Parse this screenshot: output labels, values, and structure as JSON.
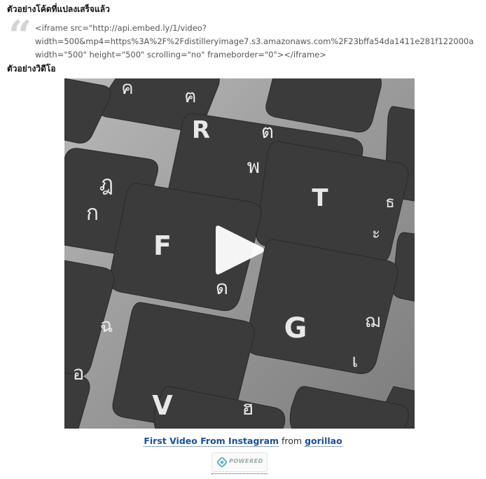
{
  "headings": {
    "converted_code": "ตัวอย่างโค้ดที่แปลงเสร็จแล้ว",
    "video_example": "ตัวอย่างวิดีโอ"
  },
  "code": {
    "line1": "<iframe src=\"http://api.embed.ly/1/video?",
    "line2": "width=500&mp4=https%3A%2F%2Fdistilleryimage7.s3.amazonaws.com%2F23bffa54da1411e281f122000a",
    "line3": "width=\"500\" height=\"500\" scrolling=\"no\" frameborder=\"0\"></iframe>"
  },
  "video": {
    "keys": {
      "k1": "ค",
      "k2": "ฅ",
      "k3": "R",
      "k4": "ต",
      "k5": "พ",
      "k6": "ฎ",
      "k7": "ก",
      "k8": "F",
      "k9": "ด",
      "k10": "T",
      "k11": "ธ",
      "k12": "ะ",
      "k13": "ฉ",
      "k14": "ฌ",
      "k15": "G",
      "k16": "เ",
      "k17": "V",
      "k18": "ฮ",
      "k19": "อ"
    }
  },
  "caption": {
    "title_link": "First Video From Instagram",
    "from": "from",
    "author_link": "gorillao"
  },
  "powered_badge": "POWERED",
  "colors": {
    "link": "#1b4f96",
    "key_fill": "#3a3a3a",
    "keyboard_frame": "#8f8f8f"
  }
}
